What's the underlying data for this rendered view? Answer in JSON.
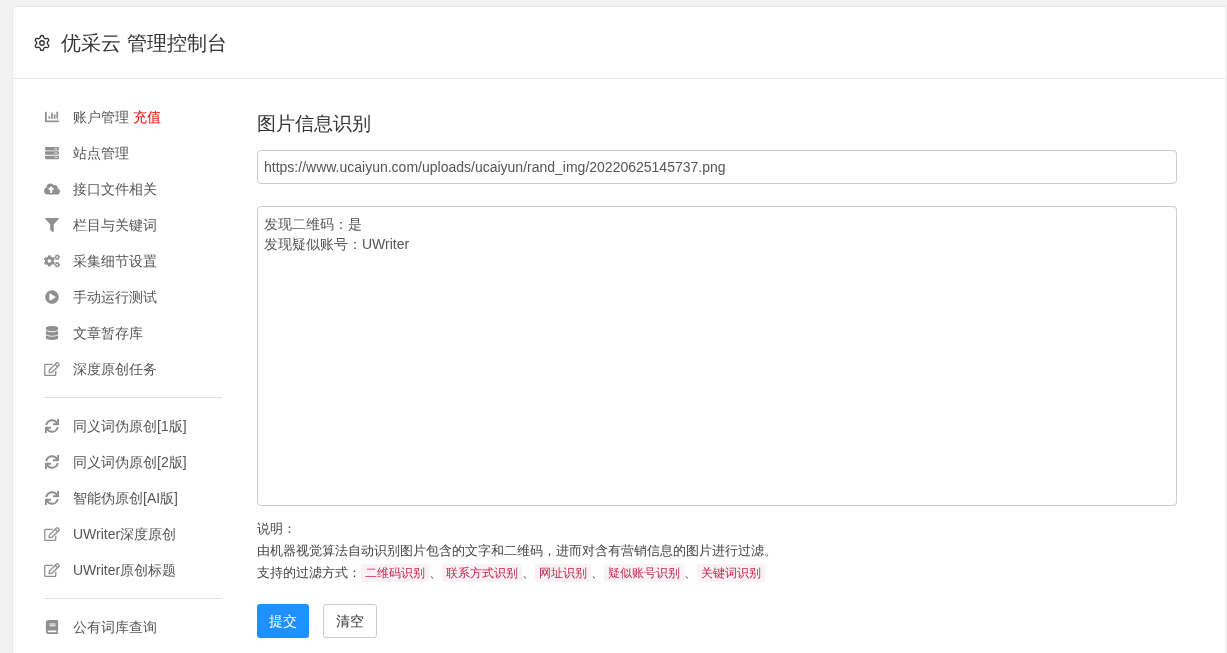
{
  "header": {
    "title": "优采云 管理控制台"
  },
  "sidebar": {
    "groups": [
      {
        "items": [
          {
            "label": "账户管理",
            "kind": "chart",
            "badge": "充值"
          },
          {
            "label": "站点管理",
            "kind": "server"
          },
          {
            "label": "接口文件相关",
            "kind": "cloud"
          },
          {
            "label": "栏目与关键词",
            "kind": "filter"
          },
          {
            "label": "采集细节设置",
            "kind": "cogs"
          },
          {
            "label": "手动运行测试",
            "kind": "play"
          },
          {
            "label": "文章暂存库",
            "kind": "database"
          },
          {
            "label": "深度原创任务",
            "kind": "edit"
          }
        ]
      },
      {
        "items": [
          {
            "label": "同义词伪原创[1版]",
            "kind": "sync"
          },
          {
            "label": "同义词伪原创[2版]",
            "kind": "sync"
          },
          {
            "label": "智能伪原创[AI版]",
            "kind": "sync"
          },
          {
            "label": "UWriter深度原创",
            "kind": "edit"
          },
          {
            "label": "UWriter原创标题",
            "kind": "edit"
          }
        ]
      },
      {
        "items": [
          {
            "label": "公有词库查询",
            "kind": "book"
          }
        ]
      }
    ]
  },
  "main": {
    "title": "图片信息识别",
    "url_field": {
      "value": "https://www.ucaiyun.com/uploads/ucaiyun/rand_img/20220625145737.png"
    },
    "result_box": {
      "lines": [
        "发现二维码：是",
        "发现疑似账号：UWriter"
      ]
    },
    "notes": {
      "heading": "说明：",
      "description": "由机器视觉算法自动识别图片包含的文字和二维码，进而对含有营销信息的图片进行过滤。",
      "methods_label": "支持的过滤方式：",
      "separator": "、",
      "methods": [
        "二维码识别",
        "联系方式识别",
        "网址识别",
        "疑似账号识别",
        "关键词识别"
      ]
    },
    "buttons": [
      {
        "label": "提交",
        "kind": "primary"
      },
      {
        "label": "清空",
        "kind": "default"
      }
    ]
  }
}
